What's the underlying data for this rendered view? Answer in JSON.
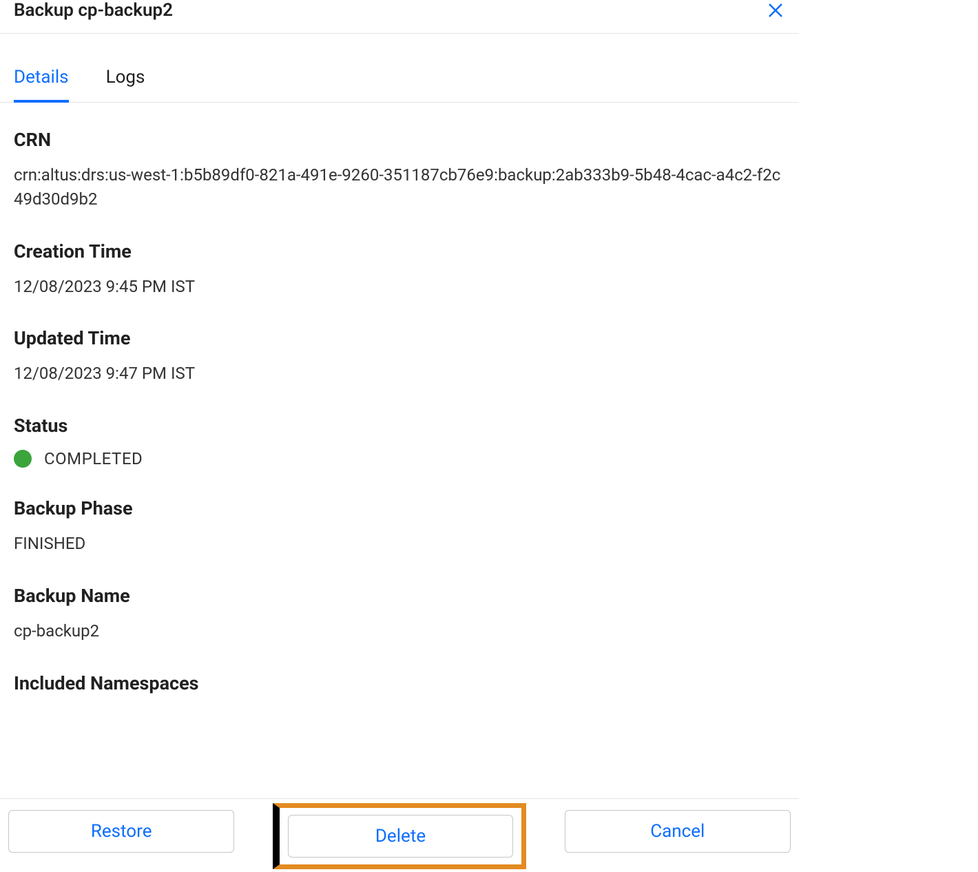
{
  "header": {
    "title": "Backup cp-backup2"
  },
  "tabs": {
    "details": "Details",
    "logs": "Logs",
    "activeIndex": 0
  },
  "details": {
    "crn_label": "CRN",
    "crn_value": "crn:altus:drs:us-west-1:b5b89df0-821a-491e-9260-351187cb76e9:backup:2ab333b9-5b48-4cac-a4c2-f2c49d30d9b2",
    "creation_label": "Creation Time",
    "creation_value": "12/08/2023 9:45 PM IST",
    "updated_label": "Updated Time",
    "updated_value": "12/08/2023 9:47 PM IST",
    "status_label": "Status",
    "status_value": "COMPLETED",
    "status_color": "#3ba43b",
    "phase_label": "Backup Phase",
    "phase_value": "FINISHED",
    "name_label": "Backup Name",
    "name_value": "cp-backup2",
    "namespaces_label": "Included Namespaces"
  },
  "footer": {
    "restore": "Restore",
    "delete": "Delete",
    "cancel": "Cancel"
  }
}
